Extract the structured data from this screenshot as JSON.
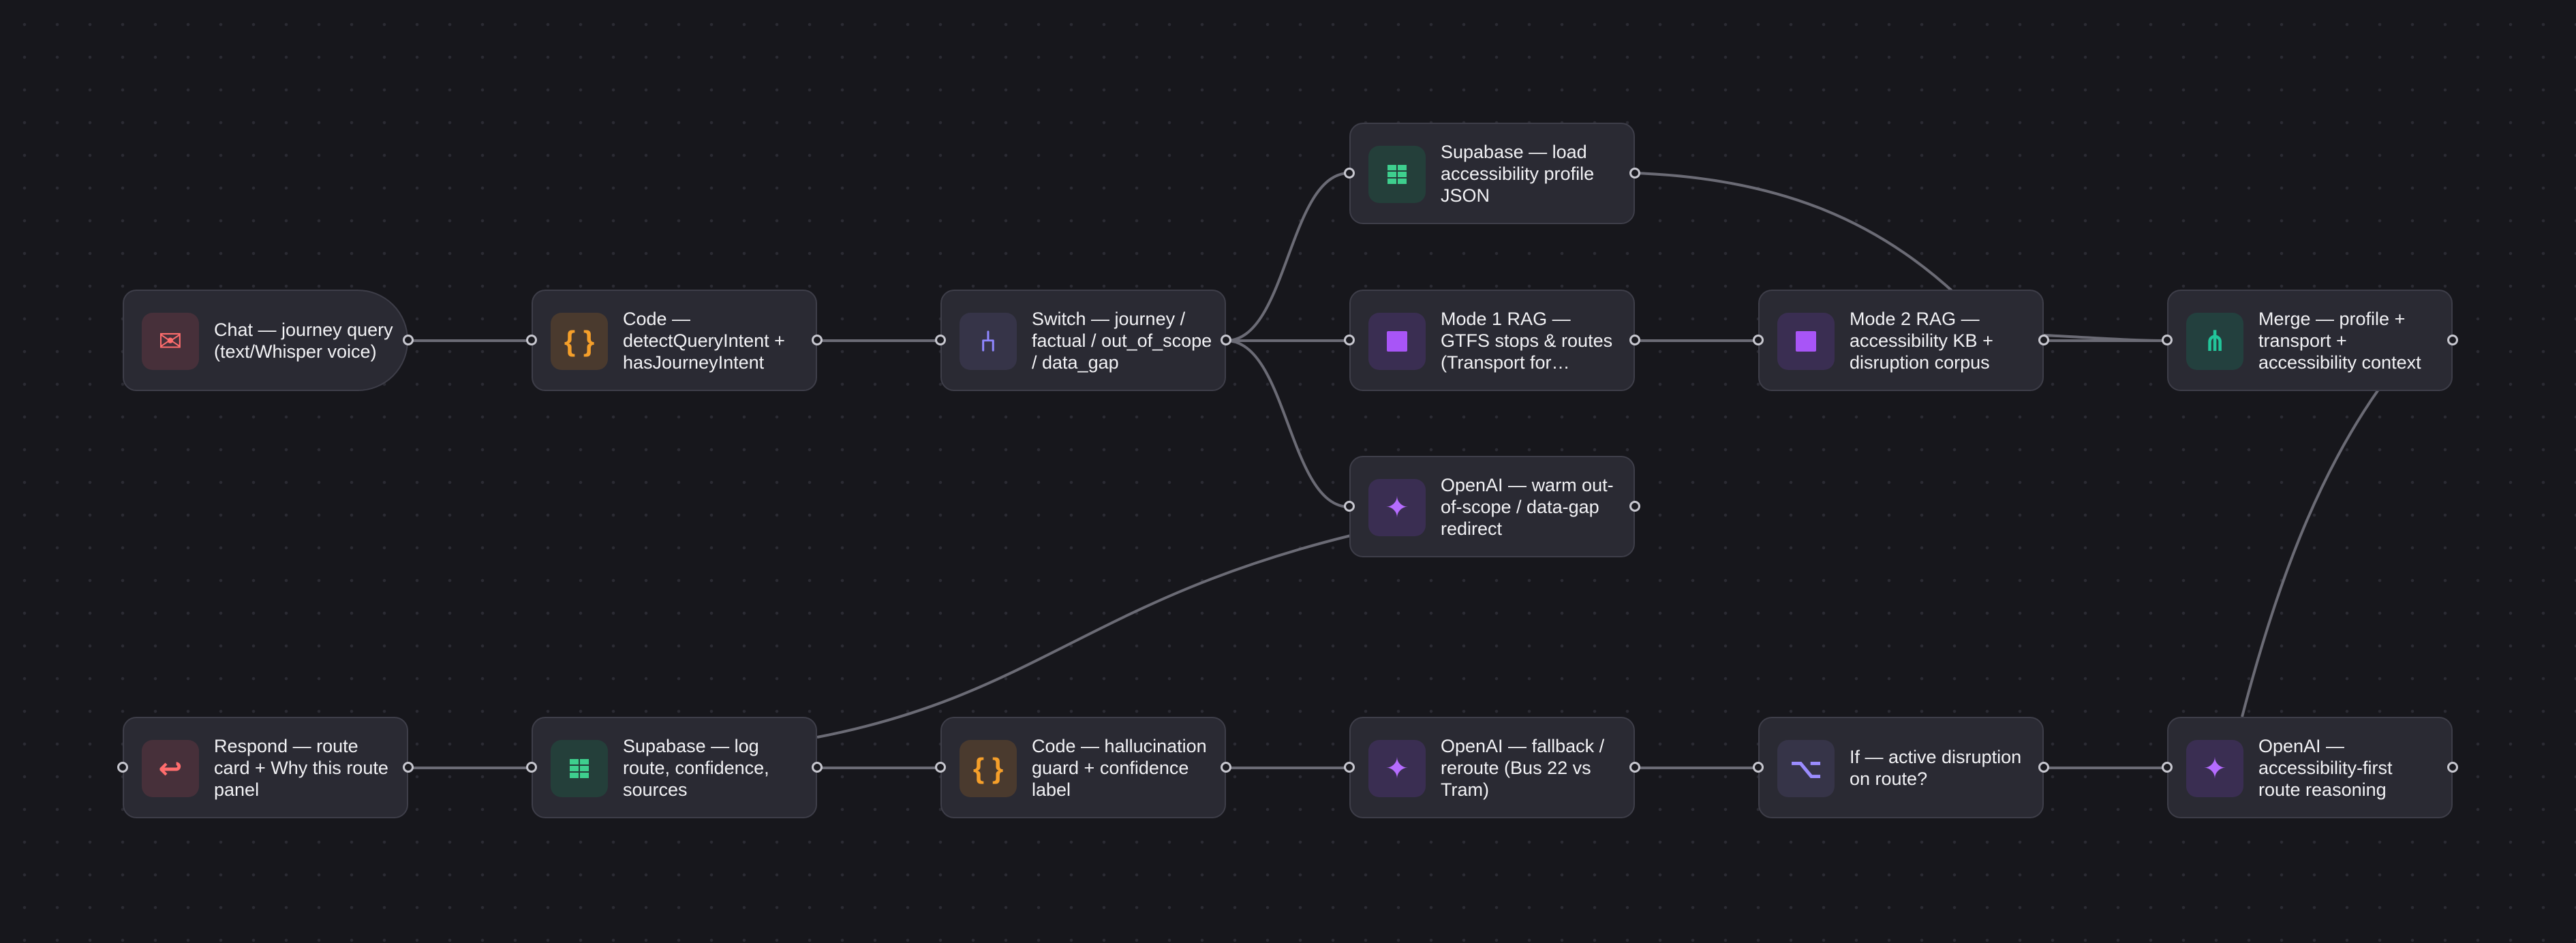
{
  "canvas": {
    "background": "#17171c",
    "edge_color": "#6b6b75"
  },
  "nodes": {
    "chat": {
      "label": "Chat — journey query (text/Whisper voice)",
      "icon": "envelope-icon",
      "glyph": "✉"
    },
    "code_intent": {
      "label": "Code — detectQueryIntent + hasJourneyIntent",
      "icon": "braces-icon",
      "glyph": "{ }"
    },
    "switch": {
      "label": "Switch — journey / factual / out_of_scope / data_gap",
      "icon": "switch-icon",
      "glyph": "⑃"
    },
    "supabase_profile": {
      "label": "Supabase — load accessibility profile JSON",
      "icon": "supabase-icon"
    },
    "mode1_rag": {
      "label": "Mode 1 RAG — GTFS stops & routes (Transport for…",
      "icon": "rag-icon"
    },
    "openai_redirect": {
      "label": "OpenAI — warm out-of-scope / data-gap redirect",
      "icon": "sparkle-icon",
      "glyph": "✦"
    },
    "mode2_rag": {
      "label": "Mode 2 RAG — accessibility KB + disruption corpus",
      "icon": "rag-icon"
    },
    "merge": {
      "label": "Merge — profile + transport + accessibility context",
      "icon": "merge-icon",
      "glyph": "⋔"
    },
    "respond": {
      "label": "Respond — route card + Why this route panel",
      "icon": "return-arrow-icon",
      "glyph": "↩"
    },
    "supabase_log": {
      "label": "Supabase — log route, confidence, sources",
      "icon": "supabase-icon"
    },
    "code_guard": {
      "label": "Code — hallucination guard + confidence label",
      "icon": "braces-icon",
      "glyph": "{ }"
    },
    "openai_fallback": {
      "label": "OpenAI — fallback / reroute (Bus 22 vs Tram)",
      "icon": "sparkle-icon",
      "glyph": "✦"
    },
    "if_disruption": {
      "label": "If — active disruption on route?",
      "icon": "if-branch-icon",
      "glyph": "⌥"
    },
    "openai_reasoning": {
      "label": "OpenAI — accessibility-first route reasoning",
      "icon": "sparkle-icon",
      "glyph": "✦"
    }
  }
}
